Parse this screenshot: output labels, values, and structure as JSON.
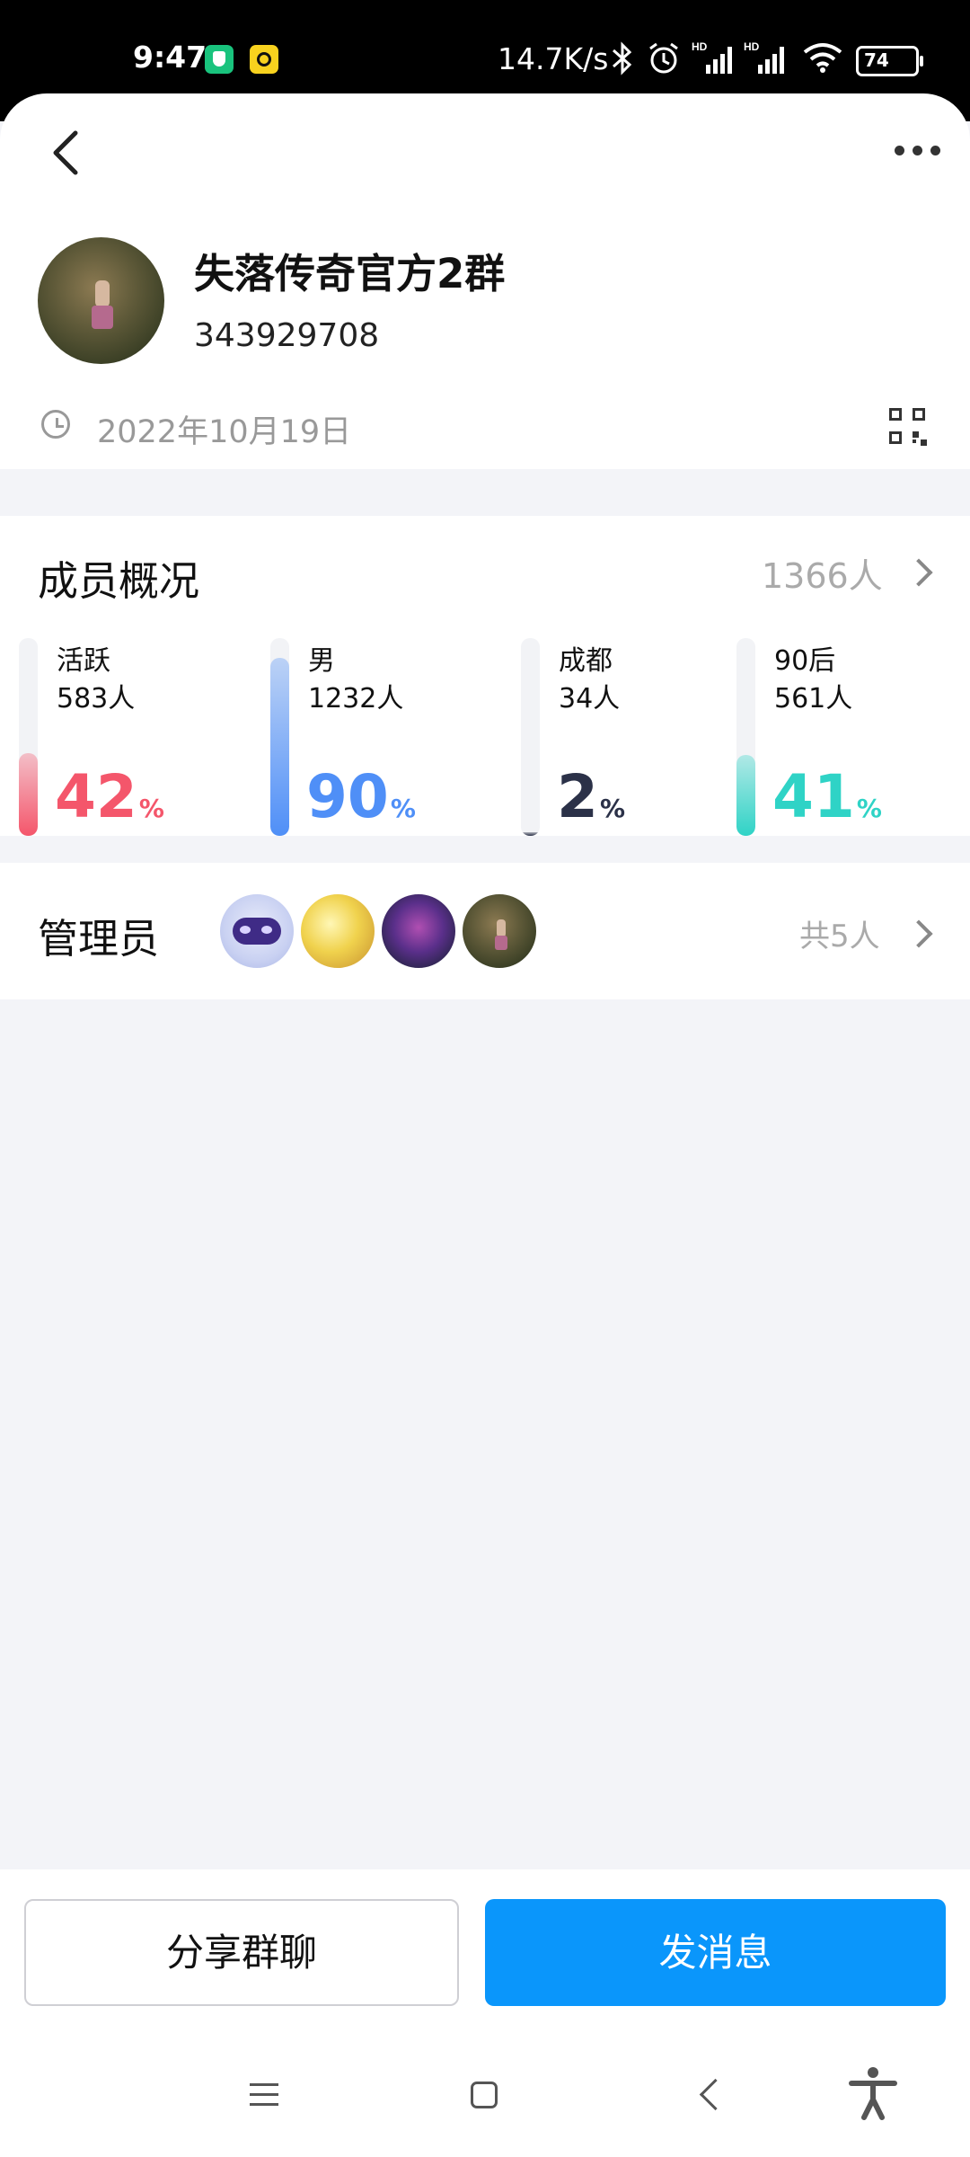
{
  "status_bar": {
    "time": "9:47",
    "network_speed": "14.7K/s",
    "battery_level": "74",
    "icons": [
      "shield-app-icon",
      "square-app-icon",
      "bluetooth-icon",
      "alarm-icon",
      "signal-hd-icon",
      "signal-hd-icon",
      "wifi-icon",
      "battery-icon"
    ]
  },
  "header": {
    "back_icon": "chevron-left-icon",
    "more_icon": "more-dots-icon"
  },
  "group": {
    "name": "失落传奇官方2群",
    "id": "343929708",
    "created_date": "2022年10月19日"
  },
  "members": {
    "title": "成员概况",
    "total": "1366人",
    "stats": [
      {
        "label": "活跃",
        "count": "583人",
        "percent": 42,
        "pct_text": "42",
        "color": "#f4566b"
      },
      {
        "label": "男",
        "count": "1232人",
        "percent": 90,
        "pct_text": "90",
        "color": "#4f8ff7"
      },
      {
        "label": "成都",
        "count": "34人",
        "percent": 2,
        "pct_text": "2",
        "color": "#2b3148"
      },
      {
        "label": "90后",
        "count": "561人",
        "percent": 41,
        "pct_text": "41",
        "color": "#2fd3c6"
      }
    ],
    "pct_sign": "%"
  },
  "admins": {
    "title": "管理员",
    "total": "共5人"
  },
  "actions": {
    "share_label": "分享群聊",
    "send_label": "发消息"
  },
  "colors": {
    "accent": "#0a96fb",
    "page_bg": "#f3f4f8"
  }
}
